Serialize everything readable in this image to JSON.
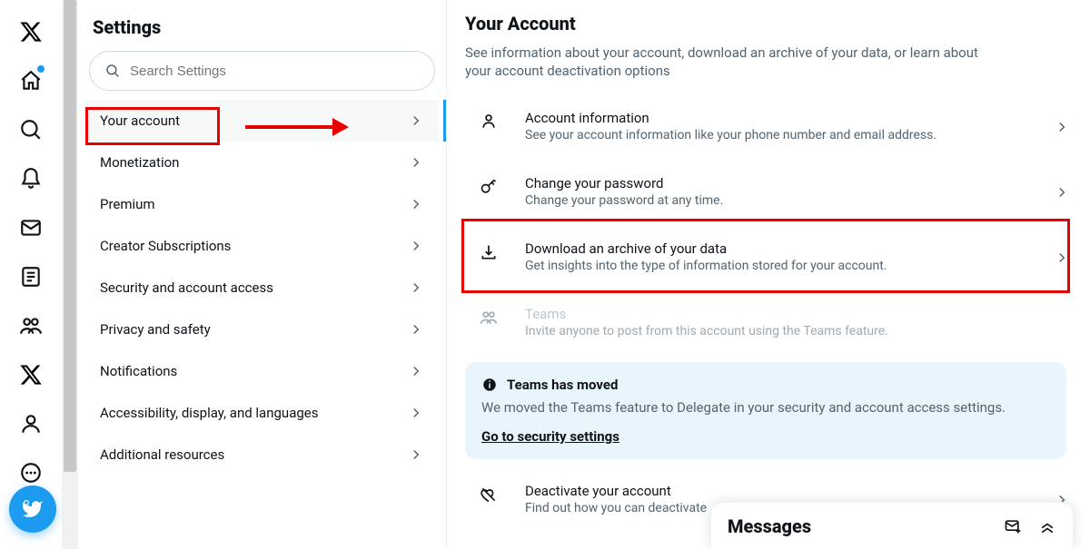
{
  "nav": {
    "items": [
      "x",
      "home",
      "search",
      "notifications",
      "messages",
      "lists",
      "communities",
      "x-premium",
      "profile",
      "more"
    ]
  },
  "settings": {
    "title": "Settings",
    "search_placeholder": "Search Settings",
    "items": [
      "Your account",
      "Monetization",
      "Premium",
      "Creator Subscriptions",
      "Security and account access",
      "Privacy and safety",
      "Notifications",
      "Accessibility, display, and languages",
      "Additional resources"
    ],
    "active_index": 0
  },
  "account": {
    "title": "Your Account",
    "description": "See information about your account, download an archive of your data, or learn about your account deactivation options",
    "items": [
      {
        "id": "info",
        "title": "Account information",
        "sub": "See your account information like your phone number and email address."
      },
      {
        "id": "password",
        "title": "Change your password",
        "sub": "Change your password at any time."
      },
      {
        "id": "archive",
        "title": "Download an archive of your data",
        "sub": "Get insights into the type of information stored for your account."
      },
      {
        "id": "teams",
        "title": "Teams",
        "sub": "Invite anyone to post from this account using the Teams feature.",
        "disabled": true
      },
      {
        "id": "deactivate",
        "title": "Deactivate your account",
        "sub": "Find out how you can deactivate"
      }
    ],
    "notice": {
      "title": "Teams has moved",
      "body": "We moved the Teams feature to Delegate in your security and account access settings.",
      "link": "Go to security settings"
    }
  },
  "messages": {
    "title": "Messages"
  },
  "colors": {
    "accent": "#1d9bf0",
    "highlight": "#e60000"
  }
}
